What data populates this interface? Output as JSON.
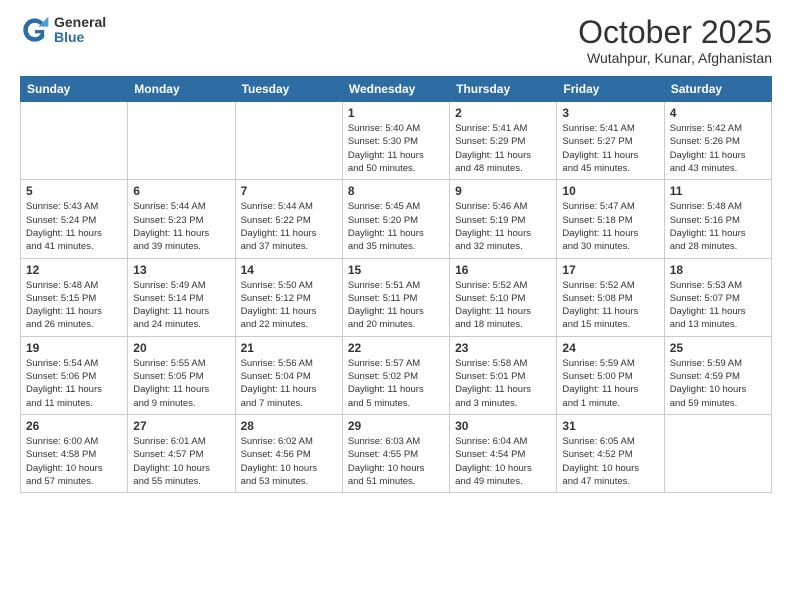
{
  "header": {
    "logo_general": "General",
    "logo_blue": "Blue",
    "title": "October 2025",
    "subtitle": "Wutahpur, Kunar, Afghanistan"
  },
  "days_of_week": [
    "Sunday",
    "Monday",
    "Tuesday",
    "Wednesday",
    "Thursday",
    "Friday",
    "Saturday"
  ],
  "weeks": [
    [
      {
        "day": "",
        "info": ""
      },
      {
        "day": "",
        "info": ""
      },
      {
        "day": "",
        "info": ""
      },
      {
        "day": "1",
        "info": "Sunrise: 5:40 AM\nSunset: 5:30 PM\nDaylight: 11 hours\nand 50 minutes."
      },
      {
        "day": "2",
        "info": "Sunrise: 5:41 AM\nSunset: 5:29 PM\nDaylight: 11 hours\nand 48 minutes."
      },
      {
        "day": "3",
        "info": "Sunrise: 5:41 AM\nSunset: 5:27 PM\nDaylight: 11 hours\nand 45 minutes."
      },
      {
        "day": "4",
        "info": "Sunrise: 5:42 AM\nSunset: 5:26 PM\nDaylight: 11 hours\nand 43 minutes."
      }
    ],
    [
      {
        "day": "5",
        "info": "Sunrise: 5:43 AM\nSunset: 5:24 PM\nDaylight: 11 hours\nand 41 minutes."
      },
      {
        "day": "6",
        "info": "Sunrise: 5:44 AM\nSunset: 5:23 PM\nDaylight: 11 hours\nand 39 minutes."
      },
      {
        "day": "7",
        "info": "Sunrise: 5:44 AM\nSunset: 5:22 PM\nDaylight: 11 hours\nand 37 minutes."
      },
      {
        "day": "8",
        "info": "Sunrise: 5:45 AM\nSunset: 5:20 PM\nDaylight: 11 hours\nand 35 minutes."
      },
      {
        "day": "9",
        "info": "Sunrise: 5:46 AM\nSunset: 5:19 PM\nDaylight: 11 hours\nand 32 minutes."
      },
      {
        "day": "10",
        "info": "Sunrise: 5:47 AM\nSunset: 5:18 PM\nDaylight: 11 hours\nand 30 minutes."
      },
      {
        "day": "11",
        "info": "Sunrise: 5:48 AM\nSunset: 5:16 PM\nDaylight: 11 hours\nand 28 minutes."
      }
    ],
    [
      {
        "day": "12",
        "info": "Sunrise: 5:48 AM\nSunset: 5:15 PM\nDaylight: 11 hours\nand 26 minutes."
      },
      {
        "day": "13",
        "info": "Sunrise: 5:49 AM\nSunset: 5:14 PM\nDaylight: 11 hours\nand 24 minutes."
      },
      {
        "day": "14",
        "info": "Sunrise: 5:50 AM\nSunset: 5:12 PM\nDaylight: 11 hours\nand 22 minutes."
      },
      {
        "day": "15",
        "info": "Sunrise: 5:51 AM\nSunset: 5:11 PM\nDaylight: 11 hours\nand 20 minutes."
      },
      {
        "day": "16",
        "info": "Sunrise: 5:52 AM\nSunset: 5:10 PM\nDaylight: 11 hours\nand 18 minutes."
      },
      {
        "day": "17",
        "info": "Sunrise: 5:52 AM\nSunset: 5:08 PM\nDaylight: 11 hours\nand 15 minutes."
      },
      {
        "day": "18",
        "info": "Sunrise: 5:53 AM\nSunset: 5:07 PM\nDaylight: 11 hours\nand 13 minutes."
      }
    ],
    [
      {
        "day": "19",
        "info": "Sunrise: 5:54 AM\nSunset: 5:06 PM\nDaylight: 11 hours\nand 11 minutes."
      },
      {
        "day": "20",
        "info": "Sunrise: 5:55 AM\nSunset: 5:05 PM\nDaylight: 11 hours\nand 9 minutes."
      },
      {
        "day": "21",
        "info": "Sunrise: 5:56 AM\nSunset: 5:04 PM\nDaylight: 11 hours\nand 7 minutes."
      },
      {
        "day": "22",
        "info": "Sunrise: 5:57 AM\nSunset: 5:02 PM\nDaylight: 11 hours\nand 5 minutes."
      },
      {
        "day": "23",
        "info": "Sunrise: 5:58 AM\nSunset: 5:01 PM\nDaylight: 11 hours\nand 3 minutes."
      },
      {
        "day": "24",
        "info": "Sunrise: 5:59 AM\nSunset: 5:00 PM\nDaylight: 11 hours\nand 1 minute."
      },
      {
        "day": "25",
        "info": "Sunrise: 5:59 AM\nSunset: 4:59 PM\nDaylight: 10 hours\nand 59 minutes."
      }
    ],
    [
      {
        "day": "26",
        "info": "Sunrise: 6:00 AM\nSunset: 4:58 PM\nDaylight: 10 hours\nand 57 minutes."
      },
      {
        "day": "27",
        "info": "Sunrise: 6:01 AM\nSunset: 4:57 PM\nDaylight: 10 hours\nand 55 minutes."
      },
      {
        "day": "28",
        "info": "Sunrise: 6:02 AM\nSunset: 4:56 PM\nDaylight: 10 hours\nand 53 minutes."
      },
      {
        "day": "29",
        "info": "Sunrise: 6:03 AM\nSunset: 4:55 PM\nDaylight: 10 hours\nand 51 minutes."
      },
      {
        "day": "30",
        "info": "Sunrise: 6:04 AM\nSunset: 4:54 PM\nDaylight: 10 hours\nand 49 minutes."
      },
      {
        "day": "31",
        "info": "Sunrise: 6:05 AM\nSunset: 4:52 PM\nDaylight: 10 hours\nand 47 minutes."
      },
      {
        "day": "",
        "info": ""
      }
    ]
  ]
}
